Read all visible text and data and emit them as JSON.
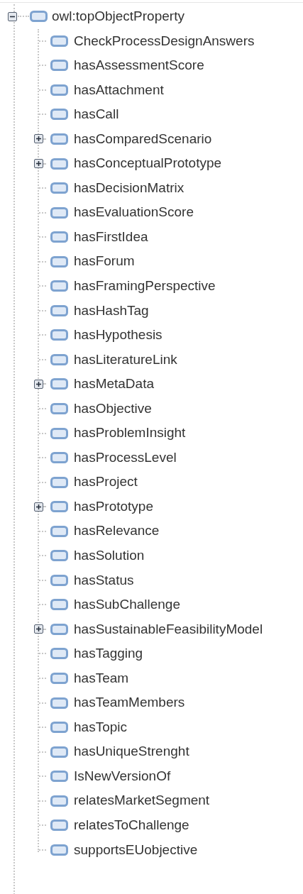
{
  "tree": {
    "label": "owl:topObjectProperty",
    "expanded": true,
    "children": [
      {
        "label": "CheckProcessDesignAnswers"
      },
      {
        "label": "hasAssessmentScore"
      },
      {
        "label": "hasAttachment"
      },
      {
        "label": "hasCall"
      },
      {
        "label": "hasComparedScenario",
        "expanded": false
      },
      {
        "label": "hasConceptualPrototype",
        "expanded": false
      },
      {
        "label": "hasDecisionMatrix"
      },
      {
        "label": "hasEvaluationScore"
      },
      {
        "label": "hasFirstIdea"
      },
      {
        "label": "hasForum"
      },
      {
        "label": "hasFramingPerspective"
      },
      {
        "label": "hasHashTag"
      },
      {
        "label": "hasHypothesis"
      },
      {
        "label": "hasLiteratureLink"
      },
      {
        "label": "hasMetaData",
        "expanded": false
      },
      {
        "label": "hasObjective"
      },
      {
        "label": "hasProblemInsight"
      },
      {
        "label": "hasProcessLevel"
      },
      {
        "label": "hasProject"
      },
      {
        "label": "hasPrototype",
        "expanded": false
      },
      {
        "label": "hasRelevance"
      },
      {
        "label": "hasSolution"
      },
      {
        "label": "hasStatus"
      },
      {
        "label": "hasSubChallenge"
      },
      {
        "label": "hasSustainableFeasibilityModel",
        "expanded": false
      },
      {
        "label": "hasTagging"
      },
      {
        "label": "hasTeam"
      },
      {
        "label": "hasTeamMembers"
      },
      {
        "label": "hasTopic"
      },
      {
        "label": "hasUniqueStrenght"
      },
      {
        "label": "IsNewVersionOf"
      },
      {
        "label": "relatesMarketSegment"
      },
      {
        "label": "relatesToChallenge"
      },
      {
        "label": "supportsEUobjective"
      }
    ]
  }
}
